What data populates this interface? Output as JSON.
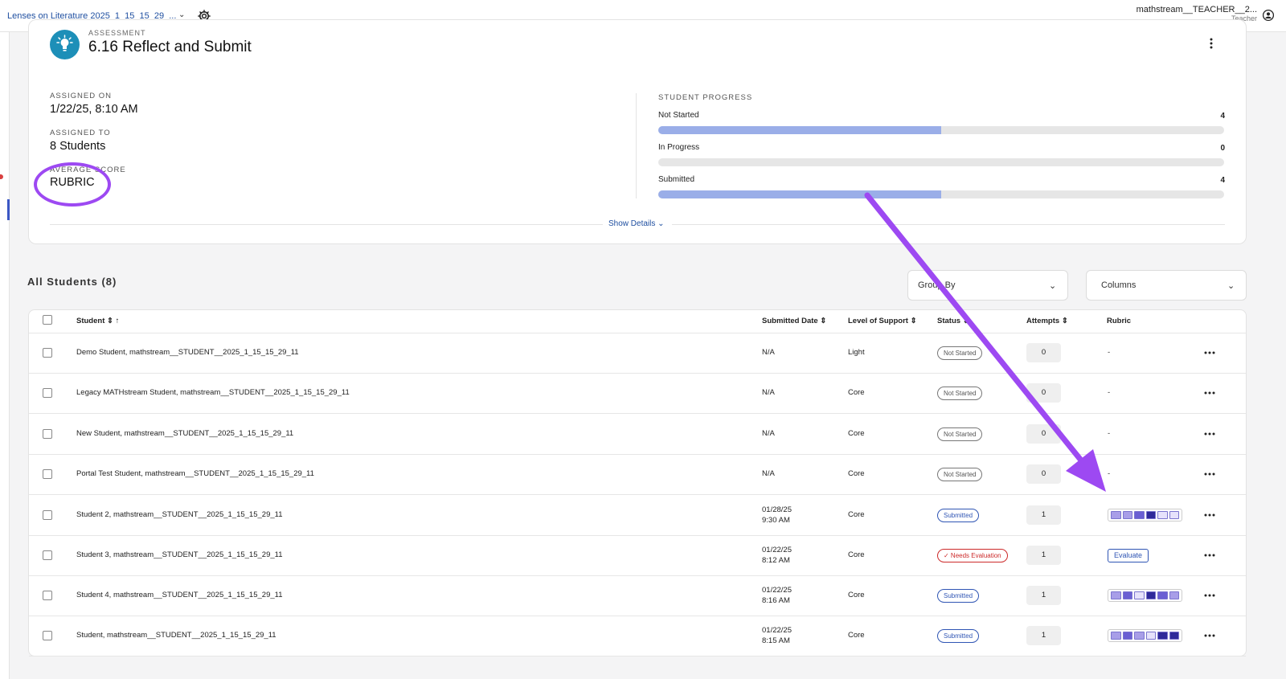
{
  "header": {
    "course_title": "Lenses on Literature 2025_1_15_15_29_...",
    "chevron": "⌄",
    "user_name": "mathstream__TEACHER__2...",
    "user_role": "Teacher"
  },
  "assessment": {
    "kicker": "ASSESSMENT",
    "title": "6.16 Reflect and Submit",
    "assigned_on_label": "ASSIGNED ON",
    "assigned_on": "1/22/25, 8:10 AM",
    "assigned_to_label": "ASSIGNED TO",
    "assigned_to": "8 Students",
    "average_score_label": "AVERAGE SCORE",
    "average_score": "RUBRIC",
    "progress_label": "STUDENT PROGRESS",
    "progress": [
      {
        "label": "Not Started",
        "count": "4",
        "fraction": 0.5
      },
      {
        "label": "In Progress",
        "count": "0",
        "fraction": 0
      },
      {
        "label": "Submitted",
        "count": "4",
        "fraction": 0.5
      }
    ],
    "show_details": "Show Details"
  },
  "students": {
    "heading": "All Students (8)",
    "group_by": "Group By",
    "columns": "Columns",
    "headers": {
      "student": "Student",
      "submitted_date": "Submitted Date",
      "level_of_support": "Level of Support",
      "status": "Status",
      "attempts": "Attempts",
      "rubric": "Rubric"
    },
    "rows": [
      {
        "name": "Demo Student, mathstream__STUDENT__2025_1_15_15_29_11",
        "date": "N/A",
        "time": "",
        "support": "Light",
        "status": "Not Started",
        "attempts": "0",
        "rubric": "-"
      },
      {
        "name": "Legacy MATHstream Student, mathstream__STUDENT__2025_1_15_15_29_11",
        "date": "N/A",
        "time": "",
        "support": "Core",
        "status": "Not Started",
        "attempts": "0",
        "rubric": "-"
      },
      {
        "name": "New Student, mathstream__STUDENT__2025_1_15_15_29_11",
        "date": "N/A",
        "time": "",
        "support": "Core",
        "status": "Not Started",
        "attempts": "0",
        "rubric": "-"
      },
      {
        "name": "Portal Test Student, mathstream__STUDENT__2025_1_15_15_29_11",
        "date": "N/A",
        "time": "",
        "support": "Core",
        "status": "Not Started",
        "attempts": "0",
        "rubric": "-"
      },
      {
        "name": "Student 2, mathstream__STUDENT__2025_1_15_15_29_11",
        "date": "01/28/25",
        "time": "9:30 AM",
        "support": "Core",
        "status": "Submitted",
        "attempts": "1",
        "rubric": "bars"
      },
      {
        "name": "Student 3, mathstream__STUDENT__2025_1_15_15_29_11",
        "date": "01/22/25",
        "time": "8:12 AM",
        "support": "Core",
        "status": "✓ Needs Evaluation",
        "attempts": "1",
        "rubric": "Evaluate"
      },
      {
        "name": "Student 4, mathstream__STUDENT__2025_1_15_15_29_11",
        "date": "01/22/25",
        "time": "8:16 AM",
        "support": "Core",
        "status": "Submitted",
        "attempts": "1",
        "rubric": "bars"
      },
      {
        "name": "Student, mathstream__STUDENT__2025_1_15_15_29_11",
        "date": "01/22/25",
        "time": "8:15 AM",
        "support": "Core",
        "status": "Submitted",
        "attempts": "1",
        "rubric": "bars"
      }
    ],
    "rubric_levels": {
      "row5": [
        2,
        2,
        3,
        4,
        1,
        1
      ],
      "row7": [
        2,
        3,
        1,
        4,
        3,
        2
      ],
      "row8": [
        2,
        3,
        2,
        1,
        4,
        4
      ]
    }
  },
  "colors": {
    "accent": "#9d49f2",
    "link": "#1f4fa0",
    "progress_fill": "#9aaee8",
    "rubric_shades": [
      "#ffffff",
      "#e6e2fb",
      "#a89ee8",
      "#6a5fd3",
      "#2f2a9a"
    ]
  }
}
